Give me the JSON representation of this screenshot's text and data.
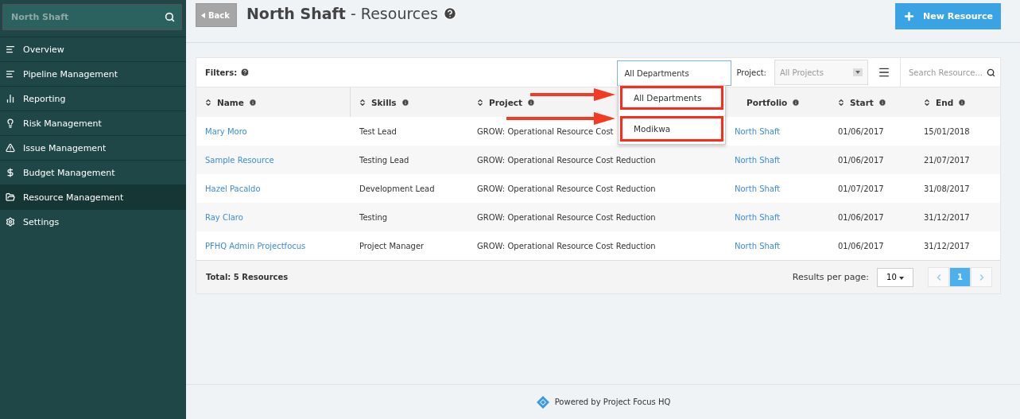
{
  "sidebar": {
    "search": {
      "placeholder": "North Shaft"
    },
    "items": [
      {
        "label": "Overview",
        "selected": false
      },
      {
        "label": "Pipeline Management",
        "selected": false
      },
      {
        "label": "Reporting",
        "selected": false
      },
      {
        "label": "Risk Management",
        "selected": false
      },
      {
        "label": "Issue Management",
        "selected": false
      },
      {
        "label": "Budget Management",
        "selected": false
      },
      {
        "label": "Resource Management",
        "selected": true
      },
      {
        "label": "Settings",
        "selected": false
      }
    ]
  },
  "header": {
    "back": "Back",
    "title": "**North Shaft** - Resources",
    "new_button": "New Resource"
  },
  "filters": {
    "label": "Filters:",
    "department": {
      "value": "All Departments",
      "expanded": true,
      "options": [
        {
          "label": "All Departments",
          "highlighted": true
        },
        {
          "label": "Modikwa",
          "highlighted": true
        }
      ]
    },
    "project": {
      "label": "Project:",
      "placeholder": "All Projects"
    },
    "search": {
      "placeholder": "Search Resource..."
    }
  },
  "table": {
    "columns": [
      {
        "label": "Name",
        "sortable": true
      },
      {
        "label": "Skills",
        "sortable": true
      },
      {
        "label": "Project",
        "sortable": true
      },
      {
        "label": "Portfolio",
        "sortable": false
      },
      {
        "label": "Start",
        "sortable": true
      },
      {
        "label": "End",
        "sortable": true
      }
    ],
    "rows": [
      {
        "name": "Mary Moro",
        "skills": "Test Lead",
        "project": "GROW: Operational Resource Cost",
        "portfolio": "North Shaft",
        "start": "01/06/2017",
        "end": "15/01/2018"
      },
      {
        "name": "Sample Resource",
        "skills": "Testing Lead",
        "project": "GROW: Operational Resource Cost Reduction",
        "portfolio": "North Shaft",
        "start": "01/06/2017",
        "end": "21/07/2017"
      },
      {
        "name": "Hazel Pacaldo",
        "skills": "Development Lead",
        "project": "GROW: Operational Resource Cost Reduction",
        "portfolio": "North Shaft",
        "start": "01/07/2017",
        "end": "31/08/2017"
      },
      {
        "name": "Ray Claro",
        "skills": "Testing",
        "project": "GROW: Operational Resource Cost Reduction",
        "portfolio": "North Shaft",
        "start": "01/06/2017",
        "end": "31/12/2017"
      },
      {
        "name": "PFHQ Admin Projectfocus",
        "skills": "Project Manager",
        "project": "GROW: Operational Resource Cost Reduction",
        "portfolio": "North Shaft",
        "start": "01/06/2017",
        "end": "31/12/2017"
      }
    ]
  },
  "table_footer": {
    "total": "Total: 5 Resources",
    "per_page_label": "Results per page:",
    "per_page": "10",
    "pages": [
      {
        "label": "1",
        "selected": true
      }
    ]
  },
  "footer": {
    "powered_by": "Powered by Project Focus HQ"
  }
}
